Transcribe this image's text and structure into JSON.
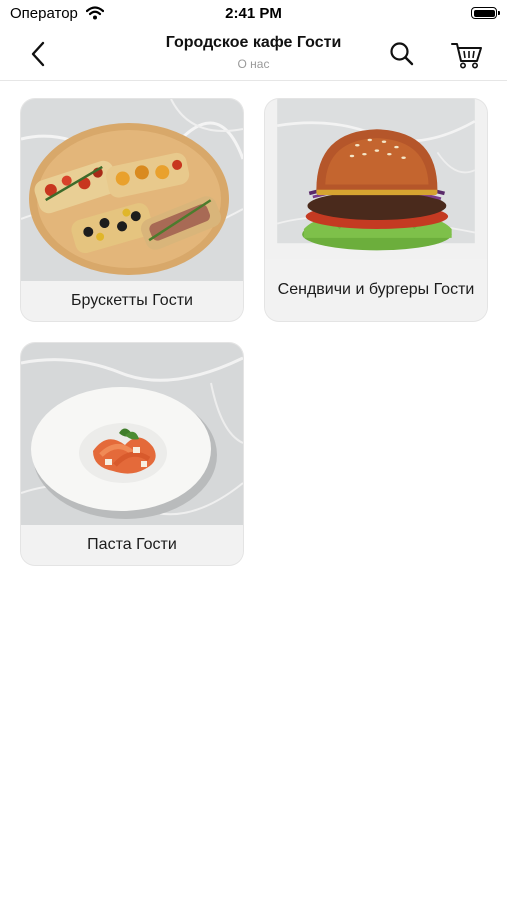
{
  "status_bar": {
    "carrier": "Оператор",
    "time": "2:41 PM"
  },
  "nav": {
    "title": "Городское кафе Гости",
    "subtitle": "О нас",
    "icons": {
      "back": "chevron-left-icon",
      "search": "search-icon",
      "cart": "cart-icon"
    }
  },
  "categories": [
    {
      "label": "Брускетты Гости",
      "image": "bruschetta-image"
    },
    {
      "label": "Сендвичи и бургеры Гости",
      "image": "burger-image"
    },
    {
      "label": "Паста Гости",
      "image": "pasta-image"
    }
  ],
  "colors": {
    "background": "#ffffff",
    "card_label_bg": "#f2f2f2",
    "subtitle": "#9a9a9a"
  }
}
